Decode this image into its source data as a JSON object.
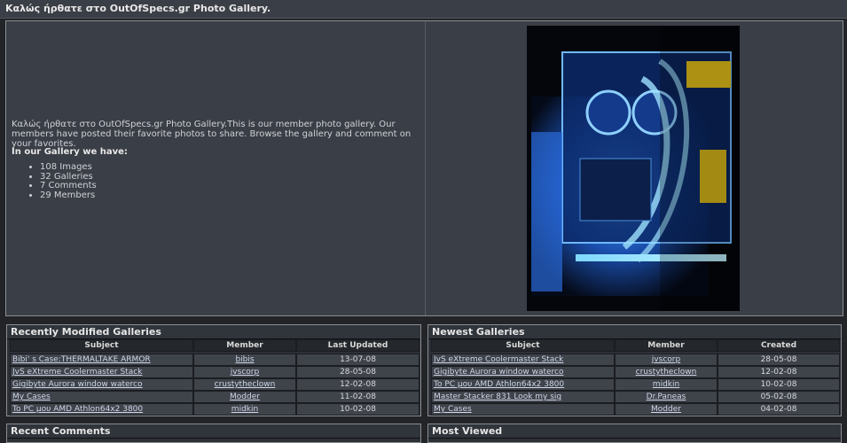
{
  "page_title": "Καλώς ήρθατε στο OutOfSpecs.gr Photo Gallery.",
  "welcome": {
    "intro": "Καλώς ήρθατε στο OutOfSpecs.gr Photo Gallery.This is our member photo gallery. Our members have posted their favorite photos to share. Browse the gallery and comment on your favorites.",
    "have_heading": "In our Gallery we have:",
    "stats": [
      "108 Images",
      "32 Galleries",
      "7 Comments",
      "29 Members"
    ]
  },
  "recent": {
    "title": "Recently Modified Galleries",
    "columns": [
      "Subject",
      "Member",
      "Last Updated"
    ],
    "rows": [
      [
        "Bibi' s Case:THERMALTAKE ARMOR",
        "bibis",
        "13-07-08"
      ],
      [
        "JvS eXtreme Coolermaster Stack",
        "jvscorp",
        "28-05-08"
      ],
      [
        "Gigibyte Aurora window waterco",
        "crustytheclown",
        "12-02-08"
      ],
      [
        "My Cases",
        "Modder",
        "11-02-08"
      ],
      [
        "To PC μου AMD Athlon64x2 3800",
        "midkin",
        "10-02-08"
      ]
    ]
  },
  "newest": {
    "title": "Newest Galleries",
    "columns": [
      "Subject",
      "Member",
      "Created"
    ],
    "rows": [
      [
        "JvS eXtreme Coolermaster Stack",
        "jvscorp",
        "28-05-08"
      ],
      [
        "Gigibyte Aurora window waterco",
        "crustytheclown",
        "12-02-08"
      ],
      [
        "To PC μου AMD Athlon64x2 3800",
        "midkin",
        "10-02-08"
      ],
      [
        "Master Stacker 831 Look my sig",
        "Dr.Paneas",
        "05-02-08"
      ],
      [
        "My Cases",
        "Modder",
        "04-02-08"
      ]
    ]
  },
  "recent_comments": {
    "title": "Recent Comments"
  },
  "most_viewed": {
    "title": "Most Viewed"
  }
}
